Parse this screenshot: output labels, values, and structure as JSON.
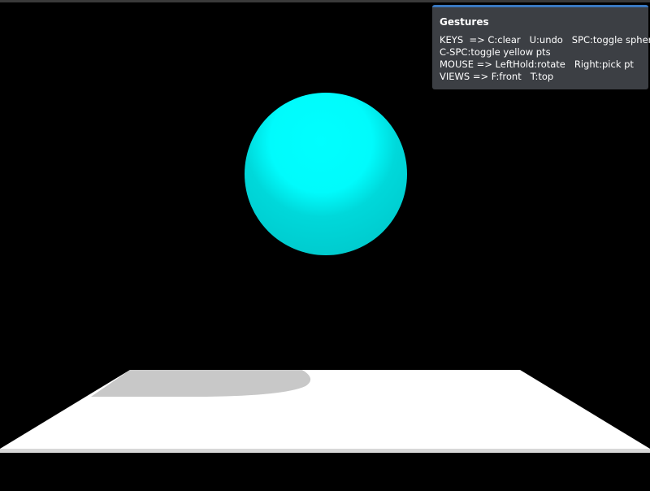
{
  "panel": {
    "title": "Gestures",
    "lines": [
      "KEYS  => C:clear   U:undo   SPC:toggle sphere",
      "C-SPC:toggle yellow pts",
      "MOUSE => LeftHold:rotate   Right:pick pt",
      "VIEWS => F:front   T:top"
    ]
  },
  "colors": {
    "background": "#000000",
    "sphere_light": "#00ffff",
    "sphere_dark": "#00cdd0",
    "ground": "#ffffff",
    "ground_edge": "#d8d8d8",
    "shadow": "#c8c8c8",
    "panel_bg": "#3c3f44",
    "panel_accent": "#3a78c0",
    "panel_text": "#ffffff"
  }
}
